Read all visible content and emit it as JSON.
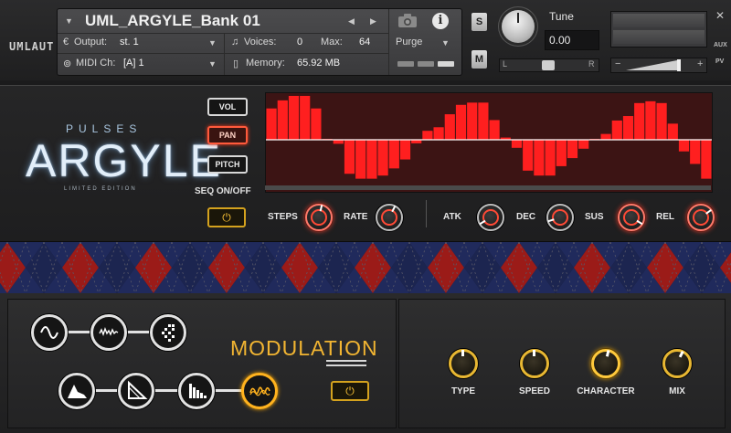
{
  "brand": {
    "logo_text": "UMLAUT"
  },
  "header": {
    "instrument_name": "UML_ARGYLE_Bank 01",
    "output_label": "Output:",
    "output_value": "st. 1",
    "midi_label": "MIDI Ch:",
    "midi_value": "[A]  1",
    "voices_label": "Voices:",
    "voices_value": "0",
    "max_label": "Max:",
    "max_value": "64",
    "memory_label": "Memory:",
    "memory_value": "65.92 MB",
    "purge_label": "Purge",
    "info_glyph": "i",
    "solo_label": "S",
    "mute_label": "M",
    "tune_label": "Tune",
    "tune_value": "0.00",
    "pan_left": "L",
    "pan_right": "R",
    "vol_minus": "−",
    "vol_plus": "+",
    "aux_label": "AUX",
    "pv_label": "PV"
  },
  "logo": {
    "pulses": "PULSES",
    "argyle": "ARGYLE",
    "edition": "LIMITED EDITION"
  },
  "modes": {
    "vol": "VOL",
    "pan": "PAN",
    "pitch": "PITCH",
    "active": "pan",
    "seq_label": "SEQ ON/OFF"
  },
  "sequencer": {
    "steps": [
      0.7,
      0.88,
      0.98,
      0.98,
      0.7,
      0.02,
      -0.09,
      -0.76,
      -0.87,
      -0.87,
      -0.8,
      -0.64,
      -0.44,
      -0.08,
      0.2,
      0.28,
      0.57,
      0.78,
      0.83,
      0.83,
      0.44,
      0.05,
      -0.18,
      -0.69,
      -0.8,
      -0.8,
      -0.59,
      -0.41,
      -0.2,
      0.02,
      0.13,
      0.43,
      0.53,
      0.82,
      0.86,
      0.82,
      0.36,
      -0.26,
      -0.54,
      -0.87
    ]
  },
  "env_knobs": [
    {
      "label": "STEPS",
      "value": 0.55,
      "glow": true
    },
    {
      "label": "RATE",
      "value": 0.6,
      "glow": false
    },
    {
      "label": "ATK",
      "value": 0.05,
      "glow": false
    },
    {
      "label": "DEC",
      "value": 0.1,
      "glow": false
    },
    {
      "label": "SUS",
      "value": 0.95,
      "glow": true
    },
    {
      "label": "REL",
      "value": 0.7,
      "glow": true
    }
  ],
  "modulation": {
    "title": "MODULATION",
    "waveforms": [
      {
        "name": "sine-wave-icon",
        "selected": false
      },
      {
        "name": "noise-wave-icon",
        "selected": false
      },
      {
        "name": "random-steps-icon",
        "selected": false
      },
      {
        "name": "envelope-icon",
        "selected": false
      },
      {
        "name": "ramp-down-icon",
        "selected": false
      },
      {
        "name": "stepped-decay-icon",
        "selected": false
      },
      {
        "name": "spiral-icon",
        "selected": true
      }
    ],
    "knobs": [
      {
        "label": "TYPE",
        "value": 0.5
      },
      {
        "label": "SPEED",
        "value": 0.5
      },
      {
        "label": "CHARACTER",
        "value": 0.55
      },
      {
        "label": "MIX",
        "value": 0.6
      }
    ]
  },
  "colors": {
    "seq_bar": "#ff1f1f",
    "seq_bg": "#3c1414",
    "accent_gold": "#f2b532",
    "argyle_red": "#9b1b18",
    "argyle_navy": "#141936"
  }
}
